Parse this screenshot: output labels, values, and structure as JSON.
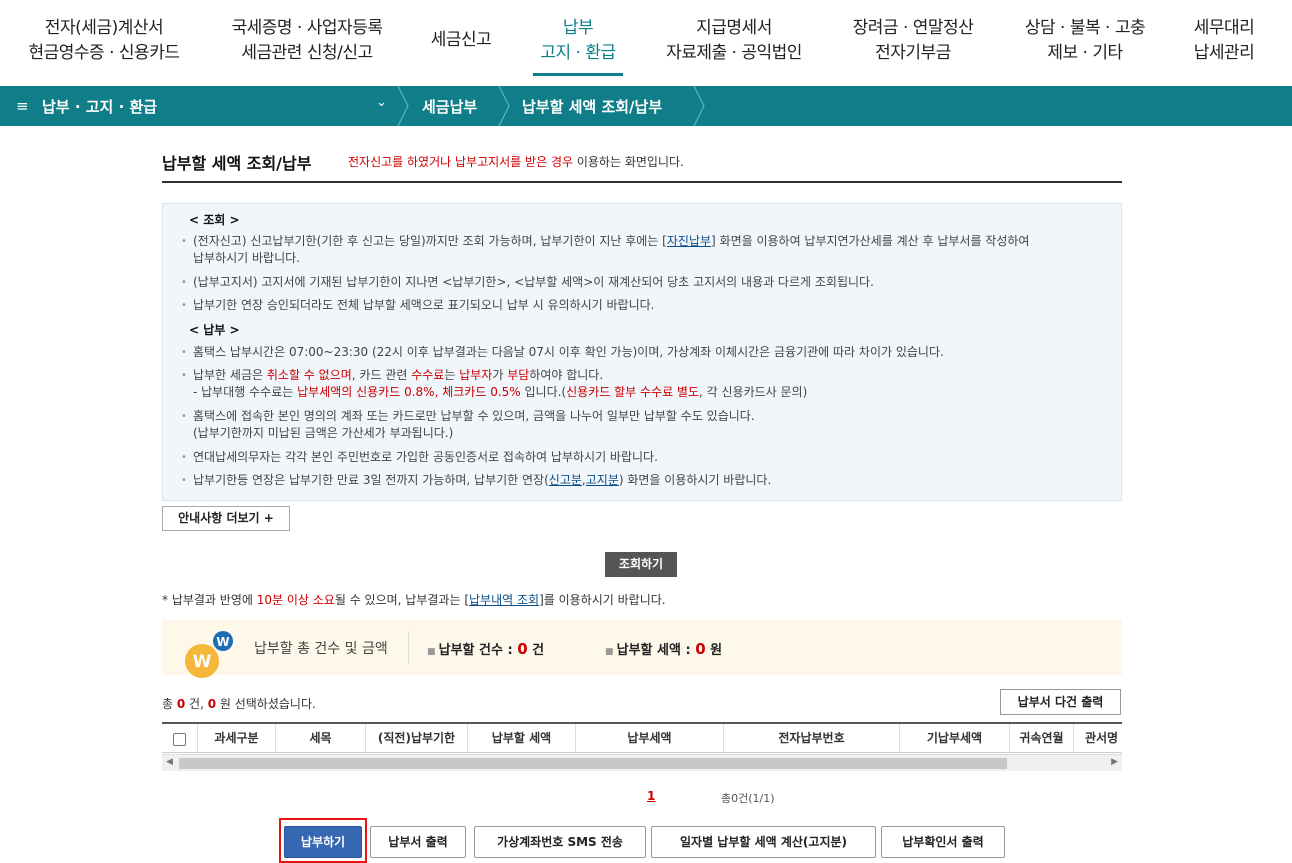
{
  "topnav": {
    "items": [
      {
        "l1": "전자(세금)계산서",
        "l2": "현금영수증 · 신용카드"
      },
      {
        "l1": "국세증명 · 사업자등록",
        "l2": "세금관련 신청/신고"
      },
      {
        "l1": "세금신고",
        "l2": ""
      },
      {
        "l1": "납부",
        "l2": "고지 · 환급"
      },
      {
        "l1": "지급명세서",
        "l2": "자료제출 · 공익법인"
      },
      {
        "l1": "장려금 · 연말정산",
        "l2": "전자기부금"
      },
      {
        "l1": "상담 · 불복 · 고충",
        "l2": "제보 · 기타"
      },
      {
        "l1": "세무대리",
        "l2": "납세관리"
      }
    ]
  },
  "breadcrumb": {
    "menu_icon": "≡",
    "level1": "납부 · 고지 · 환급",
    "chevron": "⌄",
    "level2": "세금납부",
    "level3": "납부할 세액 조회/납부"
  },
  "page": {
    "title": "납부할 세액 조회/납부",
    "subtitle_red": "전자신고를 하였거나 납부고지서를 받은 경우",
    "subtitle_rest": " 이용하는 화면입니다."
  },
  "notice": {
    "head1": "< 조회 >",
    "q1a": "(전자신고) 신고납부기한(기한 후 신고는 당일)까지만 조회 가능하며, 납부기한이 지난 후에는 [",
    "q1link": "자진납부",
    "q1b": "] 화면을 이용하여 납부지연가산세를 계산 후 납부서를 작성하여",
    "q1c": "납부하시기 바랍니다.",
    "q2": "(납부고지서) 고지서에 기재된 납부기한이 지나면 <납부기한>, <납부할 세액>이 재계산되어 당초 고지서의 내용과 다르게 조회됩니다.",
    "q3": "납부기한 연장 승인되더라도 전체 납부할 세액으로 표기되오니 납부 시 유의하시기 바랍니다.",
    "head2": "< 납부 >",
    "p1": "홈택스 납부시간은 07:00~23:30 (22시 이후 납부결과는 다음날 07시 이후 확인 가능)이며, 가상계좌 이체시간은 금융기관에 따라 차이가 있습니다.",
    "p2a": "납부한 세금은 ",
    "p2red1": "취소할 수 없으며",
    "p2b": ", 카드 관련 ",
    "p2red2": "수수료",
    "p2c": "는 ",
    "p2red3": "납부자",
    "p2d": "가 ",
    "p2red4": "부담",
    "p2e": "하여야 합니다.",
    "p2f": "- 납부대행 수수료는 ",
    "p2red5": "납부세액의 신용카드 0.8%, 체크카드 0.5%",
    "p2g": " 입니다.(",
    "p2red6": "신용카드 할부 수수료 별도",
    "p2h": ", 각 신용카드사 문의)",
    "p3a": "홈택스에 접속한 본인 명의의 계좌 또는 카드로만 납부할 수 있으며, 금액을 나누어 일부만 납부할 수도 있습니다.",
    "p3b": "(납부기한까지 미납된 금액은 가산세가 부과됩니다.)",
    "p4": "연대납세의무자는 각각 본인 주민번호로 가입한 공동인증서로 접속하여 납부하시기 바랍니다.",
    "p5a": "납부기한등 연장은 납부기한 만료 3일 전까지 가능하며, 납부기한 연장(",
    "p5link1": "신고분",
    "p5sep": ",",
    "p5link2": "고지분",
    "p5b": ") 화면을 이용하시기 바랍니다."
  },
  "buttons": {
    "more": "안내사항 더보기 +",
    "search": "조회하기",
    "multi_print": "납부서 다건 출력",
    "pay": "납부하기",
    "print": "납부서 출력",
    "sms": "가상계좌번호 SMS 전송",
    "daily_calc": "일자별 납부할 세액 계산(고지분)",
    "confirm_print": "납부확인서 출력"
  },
  "result_note": {
    "a": "* 납부결과 반영에 ",
    "red": "10분 이상 소요",
    "b": "될 수 있으며, 납부결과는 [",
    "link": "납부내역 조회",
    "c": "]를 이용하시기 바랍니다."
  },
  "summary": {
    "title": "납부할 총 건수 및 금액",
    "count_label": "납부할 건수 : ",
    "count_value": "0",
    "count_unit": " 건",
    "amount_label": "납부할 세액 : ",
    "amount_value": "0",
    "amount_unit": " 원"
  },
  "selection": {
    "a": "총 ",
    "count": "0",
    "b": " 건, ",
    "amount": "0",
    "c": " 원 선택하셨습니다."
  },
  "table": {
    "columns": [
      "과세구분",
      "세목",
      "(직전)납부기한",
      "납부할 세액",
      "납부세액",
      "전자납부번호",
      "기납부세액",
      "귀속연월",
      "관서명"
    ]
  },
  "pagination": {
    "current": "1",
    "summary": "총0건(1/1)"
  },
  "colors": {
    "accent": "#0f7e88",
    "primary_button": "#3667b3",
    "highlight": "#e11111"
  }
}
